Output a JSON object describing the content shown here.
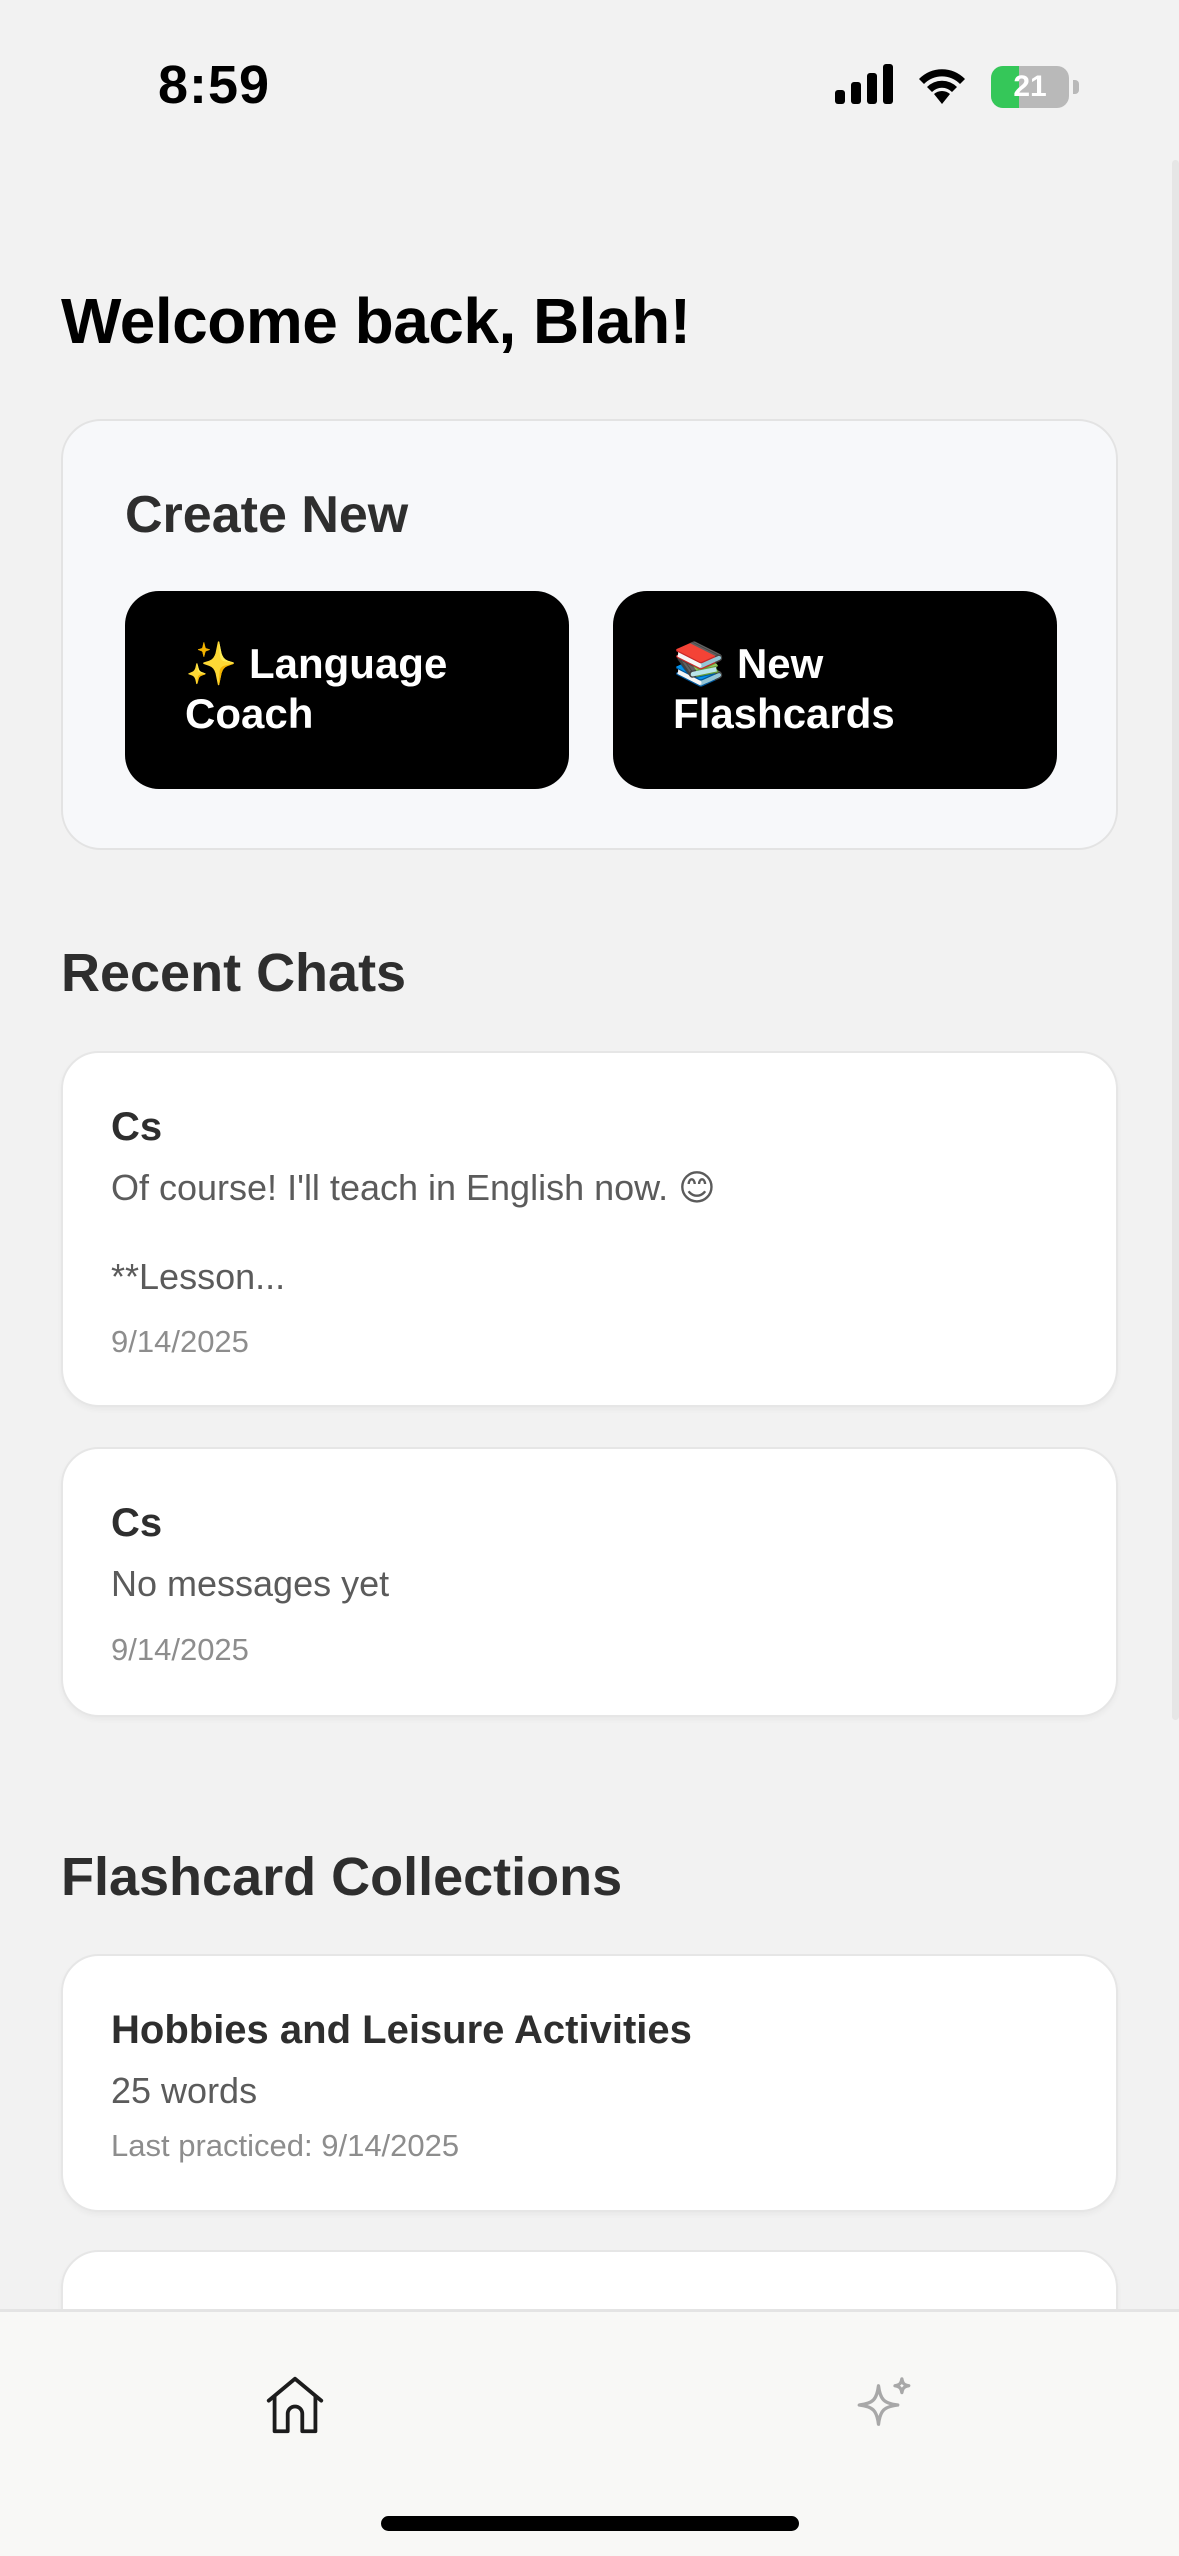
{
  "status_bar": {
    "time": "8:59",
    "battery_level": "21",
    "icons": [
      "cellular-signal-icon",
      "wifi-icon",
      "battery-charging-icon"
    ]
  },
  "welcome": {
    "title": "Welcome back, Blah!"
  },
  "create_new": {
    "title": "Create New",
    "buttons": [
      {
        "emoji": "✨",
        "label_line1": "Language",
        "label_line2": "Coach"
      },
      {
        "emoji": "📚",
        "label_line1": "New",
        "label_line2": "Flashcards"
      }
    ]
  },
  "recent_chats": {
    "title": "Recent Chats",
    "items": [
      {
        "title": "Cs",
        "preview_line1": "Of course! I'll teach in English now. 😊",
        "preview_line2": "**Lesson...",
        "date": "9/14/2025"
      },
      {
        "title": "Cs",
        "preview_line1": "No messages yet",
        "date": "9/14/2025"
      }
    ]
  },
  "flashcards": {
    "title": "Flashcard Collections",
    "items": [
      {
        "title": "Hobbies and Leisure Activities",
        "count": "25 words",
        "last_practiced": "Last practiced: 9/14/2025"
      }
    ]
  },
  "tab_bar": {
    "tabs": [
      {
        "icon": "home-icon",
        "active": true
      },
      {
        "icon": "sparkle-icon",
        "active": false
      }
    ],
    "colors": {
      "active": "#1c1c1c",
      "inactive": "#a8a8a8"
    }
  }
}
